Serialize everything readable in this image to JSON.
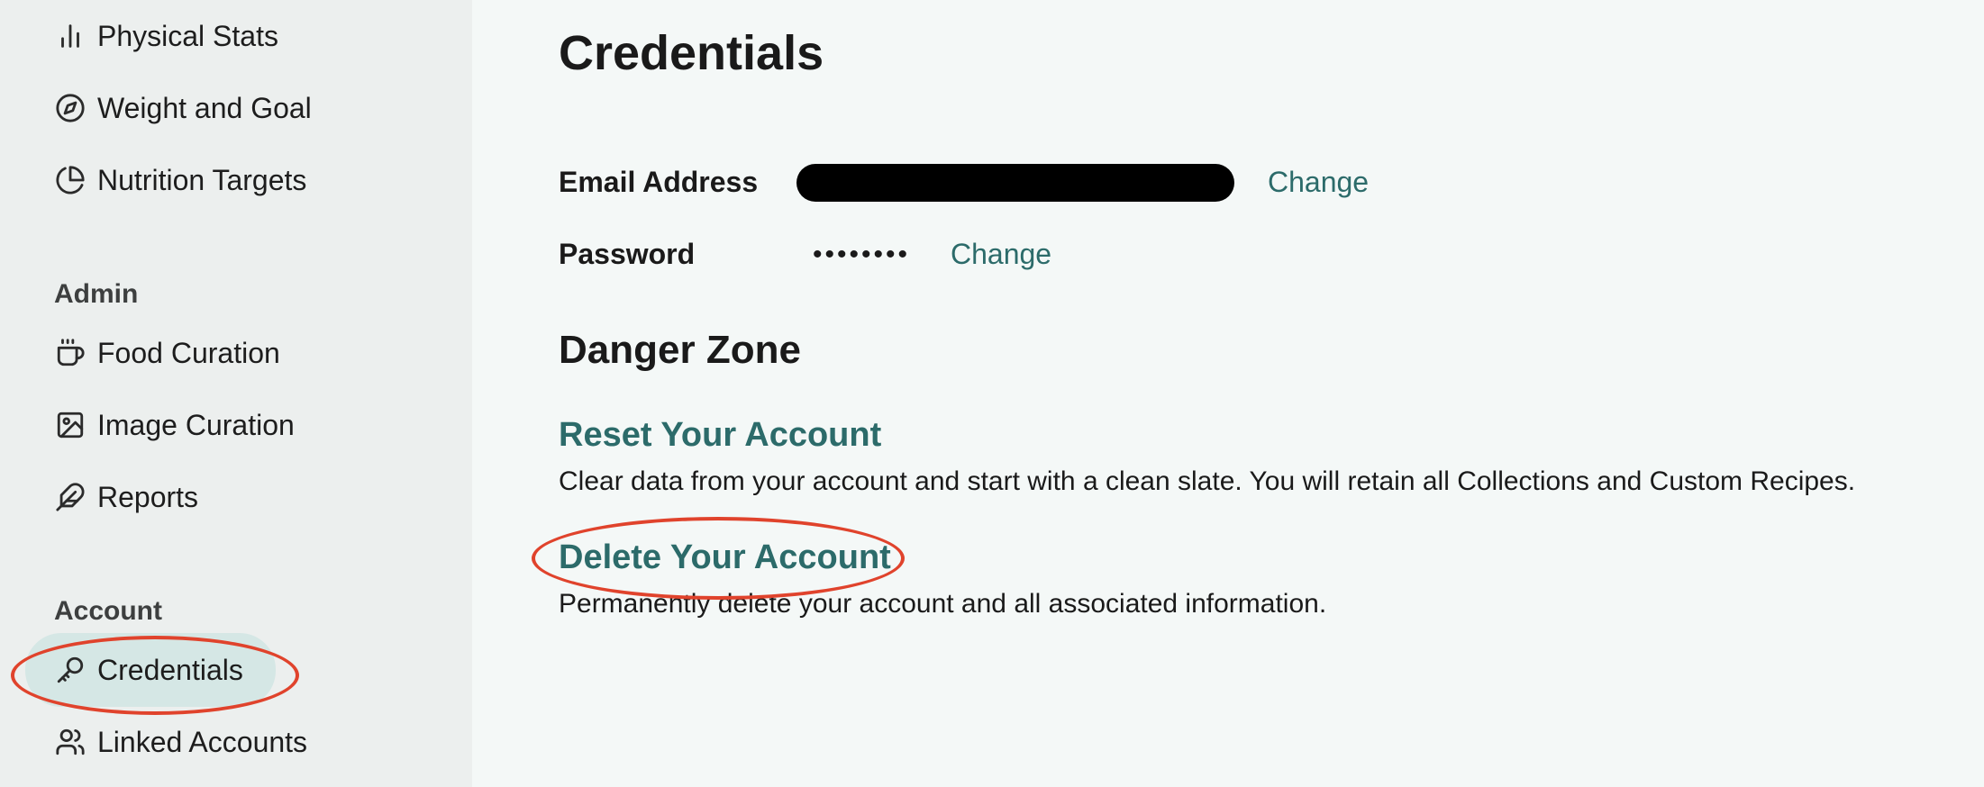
{
  "sidebar": {
    "items_top": [
      {
        "label": "Physical Stats",
        "icon": "bar-chart-icon"
      },
      {
        "label": "Weight and Goal",
        "icon": "compass-icon"
      },
      {
        "label": "Nutrition Targets",
        "icon": "pie-chart-icon"
      }
    ],
    "admin_label": "Admin",
    "admin_items": [
      {
        "label": "Food Curation",
        "icon": "coffee-cup-icon"
      },
      {
        "label": "Image Curation",
        "icon": "image-icon"
      },
      {
        "label": "Reports",
        "icon": "feather-icon"
      }
    ],
    "account_label": "Account",
    "account_items": [
      {
        "label": "Credentials",
        "icon": "key-icon",
        "active": true
      },
      {
        "label": "Linked Accounts",
        "icon": "users-icon"
      }
    ]
  },
  "main": {
    "title": "Credentials",
    "email_label": "Email Address",
    "email_change": "Change",
    "password_label": "Password",
    "password_mask": "••••••••",
    "password_change": "Change",
    "danger_title": "Danger Zone",
    "reset_title": "Reset Your Account",
    "reset_desc": "Clear data from your account and start with a clean slate. You will retain all Collections and Custom Recipes.",
    "delete_title": "Delete Your Account",
    "delete_desc": "Permanently delete your account and all associated information."
  },
  "colors": {
    "accent": "#2c6b6a",
    "annotation": "#e0432c",
    "active_bg": "#d5e7e5"
  }
}
